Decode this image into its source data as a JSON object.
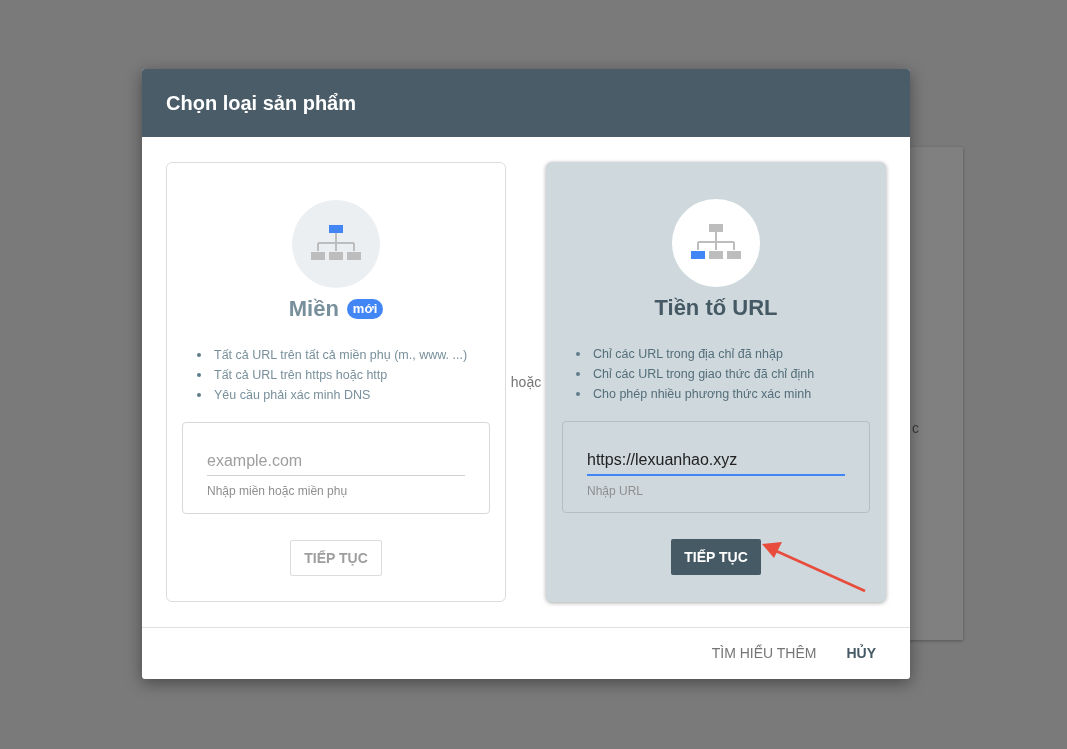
{
  "background_page": {
    "text": "c"
  },
  "dialog": {
    "title": "Chọn loại sản phẩm",
    "separator": "hoặc",
    "cards": [
      {
        "title": "Miền",
        "badge": "mới",
        "selected": false,
        "kind": "domain",
        "bullets": [
          "Tất cả URL trên tất cả miền phụ (m., www. ...)",
          "Tất cả URL trên https hoặc http",
          "Yêu cầu phải xác minh DNS"
        ],
        "field": {
          "placeholder": "example.com",
          "helper": "Nhập miền hoặc miền phụ",
          "focused": false
        },
        "button": {
          "label": "TIẾP TỤC",
          "disabled": true
        }
      },
      {
        "title": "Tiền tố URL",
        "selected": true,
        "kind": "prefix",
        "bullets": [
          "Chỉ các URL trong địa chỉ đã nhập",
          "Chỉ các URL trong giao thức đã chỉ định",
          "Cho phép nhiều phương thức xác minh"
        ],
        "field": {
          "value": "https://lexuanhao.xyz",
          "helper": "Nhập URL",
          "focused": true
        },
        "button": {
          "label": "TIẾP TỤC",
          "disabled": false
        }
      }
    ],
    "footer_buttons": [
      {
        "label": "TÌM HIỂU THÊM",
        "primary": false
      },
      {
        "label": "HỦY",
        "primary": true
      }
    ]
  }
}
